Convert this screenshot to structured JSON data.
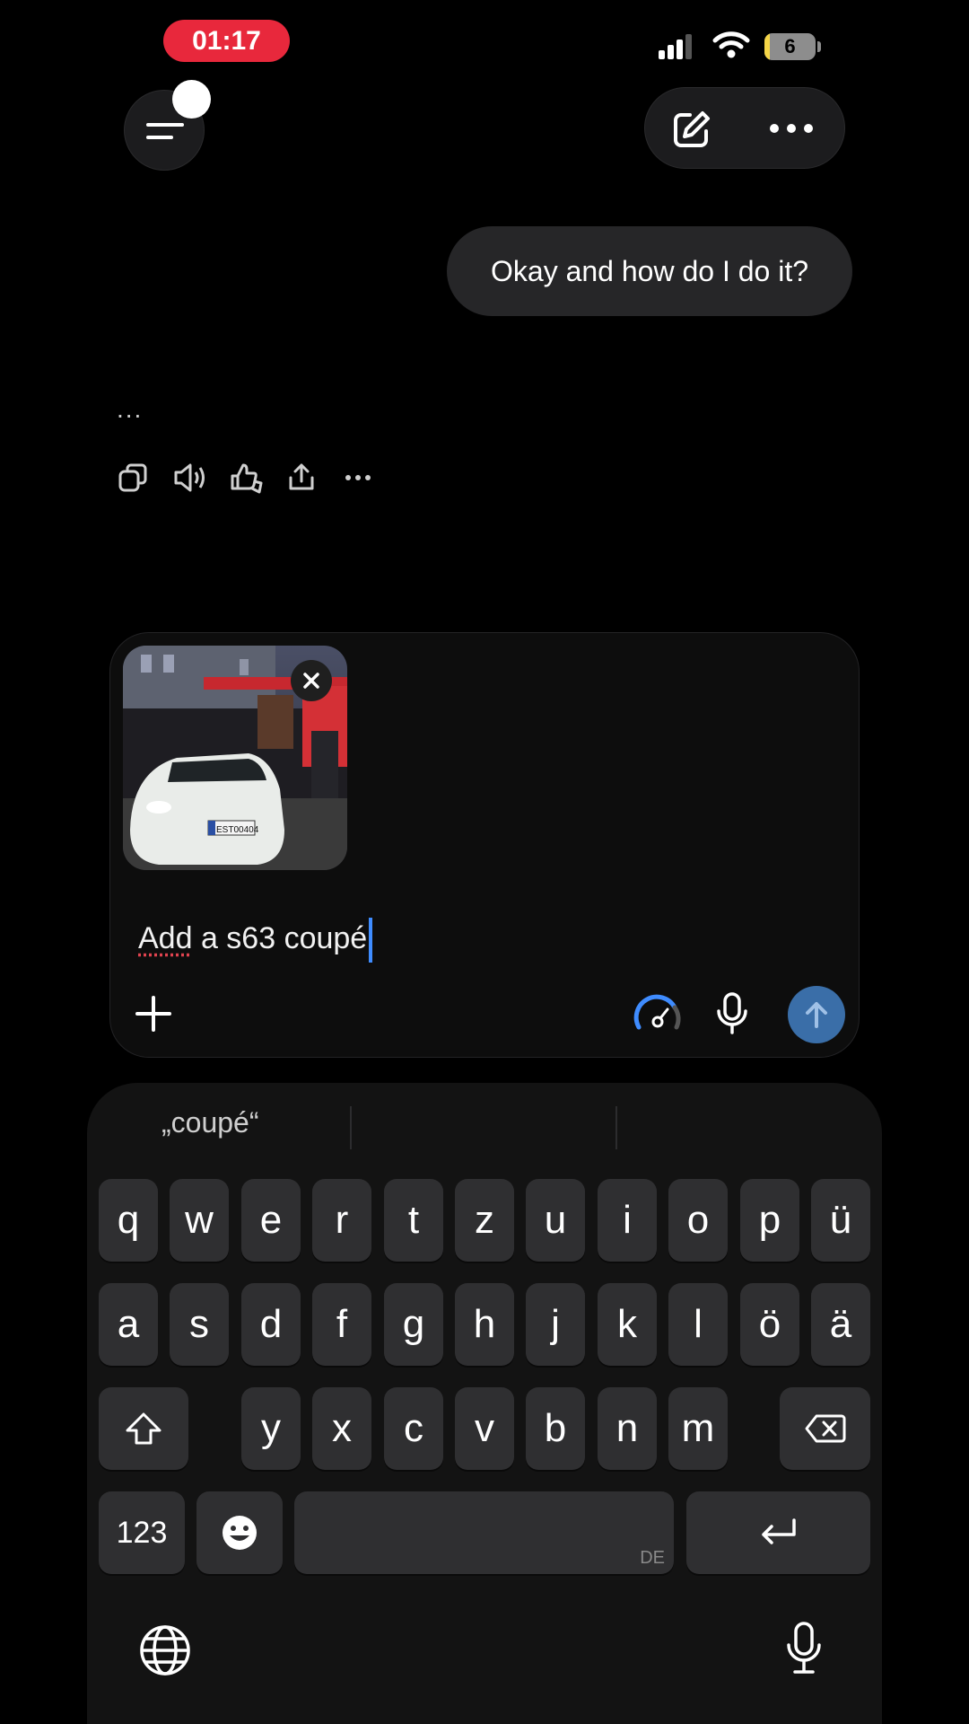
{
  "status_bar": {
    "time": "01:17",
    "battery": "6"
  },
  "chat": {
    "user_message": "Okay and how do I do it?",
    "assistant_typing": "..."
  },
  "composer": {
    "text_first_word": "Add",
    "text_rest": " a s63 coupé",
    "attachment_plate": "EST00404"
  },
  "keyboard": {
    "suggestion": "„coupé“",
    "row1": [
      "q",
      "w",
      "e",
      "r",
      "t",
      "z",
      "u",
      "i",
      "o",
      "p",
      "ü"
    ],
    "row2": [
      "a",
      "s",
      "d",
      "f",
      "g",
      "h",
      "j",
      "k",
      "l",
      "ö",
      "ä"
    ],
    "row3": [
      "y",
      "x",
      "c",
      "v",
      "b",
      "n",
      "m"
    ],
    "numbers_label": "123",
    "space_lang": "DE"
  },
  "colors": {
    "accent_blue": "#3f8cff",
    "send_bg": "#3a6ea8",
    "time_pill": "#e8283c"
  }
}
